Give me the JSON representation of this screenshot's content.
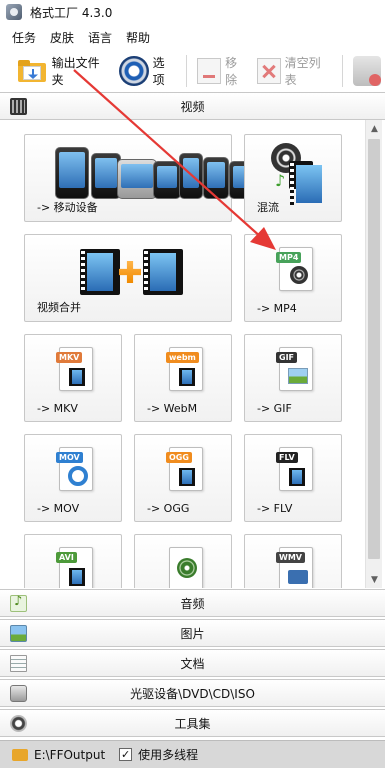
{
  "window": {
    "title": "格式工厂 4.3.0"
  },
  "menu": [
    "任务",
    "皮肤",
    "语言",
    "帮助"
  ],
  "toolbar": {
    "output_folder": "输出文件夹",
    "options": "选项",
    "remove": "移除",
    "clear_list": "清空列表"
  },
  "categories": {
    "video": "视频",
    "audio": "音频",
    "image": "图片",
    "document": "文档",
    "disc": "光驱设备\\DVD\\CD\\ISO",
    "tools": "工具集"
  },
  "tiles": {
    "mobile": "-> 移动设备",
    "mix": "混流",
    "merge": "视频合并",
    "mp4": "-> MP4",
    "mkv": "-> MKV",
    "webm": "-> WebM",
    "gif": "-> GIF",
    "mov": "-> MOV",
    "ogg": "-> OGG",
    "flv": "-> FLV"
  },
  "badges": {
    "mp4": "MP4",
    "mkv": "MKV",
    "webm": "webm",
    "gif": "GIF",
    "mov": "MOV",
    "ogg": "OGG",
    "flv": "FLV",
    "avi": "AVI",
    "wmv": "WMV"
  },
  "status": {
    "output_path": "E:\\FFOutput",
    "multithread": "使用多线程",
    "multithread_checked": true
  },
  "colors": {
    "arrow": "#e53935",
    "mp4_badge": "#47a25a",
    "mkv_badge": "#e07a3a",
    "webm_badge": "#f08c1e",
    "gif_badge": "#333333",
    "mov_badge": "#2f80d1",
    "ogg_badge": "#f08c1e",
    "flv_badge": "#222222",
    "avi_badge": "#4d9a3a",
    "wmv_badge": "#444444"
  }
}
